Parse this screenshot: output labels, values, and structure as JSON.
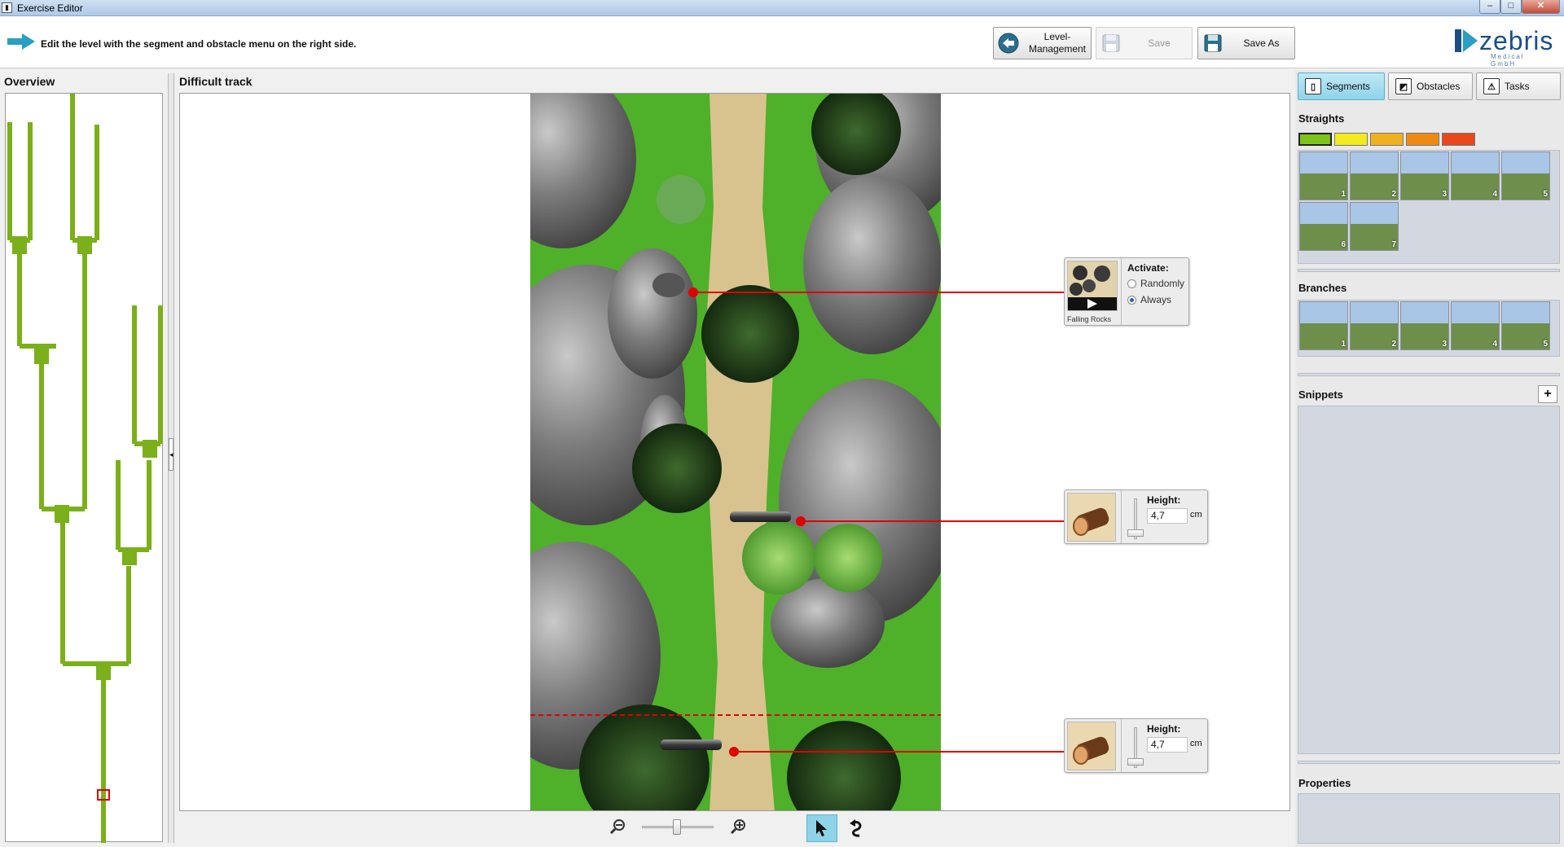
{
  "window": {
    "title": "Exercise Editor",
    "min": "–",
    "max": "□",
    "close": "✕"
  },
  "header": {
    "hint": "Edit the level with the segment and obstacle menu on the right side.",
    "level_management_line1": "Level-",
    "level_management_line2": "Management",
    "save": "Save",
    "save_as": "Save As",
    "logo_word": "zebris",
    "logo_sub": "Medical GmbH"
  },
  "overview": {
    "title": "Overview"
  },
  "track": {
    "title": "Difficult track"
  },
  "obstacles": [
    {
      "type": "Falling Rocks",
      "activate_label": "Activate:",
      "option_randomly": "Randomly",
      "option_always": "Always",
      "selected": "Always"
    },
    {
      "type": "log",
      "height_label": "Height:",
      "height_value": "4,7",
      "unit": "cm"
    },
    {
      "type": "log",
      "height_label": "Height:",
      "height_value": "4,7",
      "unit": "cm"
    }
  ],
  "right_panel": {
    "tabs": [
      {
        "label": "Segments",
        "icon": "segment-icon",
        "active": true
      },
      {
        "label": "Obstacles",
        "icon": "obstacles-icon",
        "active": false
      },
      {
        "label": "Tasks",
        "icon": "warning-icon",
        "active": false
      }
    ],
    "straights": {
      "title": "Straights",
      "difficulty_colors": [
        "#7cc31b",
        "#f2ea1d",
        "#f0b01f",
        "#ee8a14",
        "#e8471c"
      ],
      "tiles": [
        "1",
        "2",
        "3",
        "4",
        "5",
        "6",
        "7"
      ]
    },
    "branches": {
      "title": "Branches",
      "tiles": [
        "1",
        "2",
        "3",
        "4",
        "5"
      ]
    },
    "snippets": {
      "title": "Snippets",
      "add": "+"
    },
    "properties": {
      "title": "Properties"
    }
  },
  "colors": {
    "accent": "#8fd3e8",
    "overview_green": "#7bb01a",
    "marker_red": "#e10000",
    "grass": "#4fb02a",
    "path": "#d8c38e"
  }
}
